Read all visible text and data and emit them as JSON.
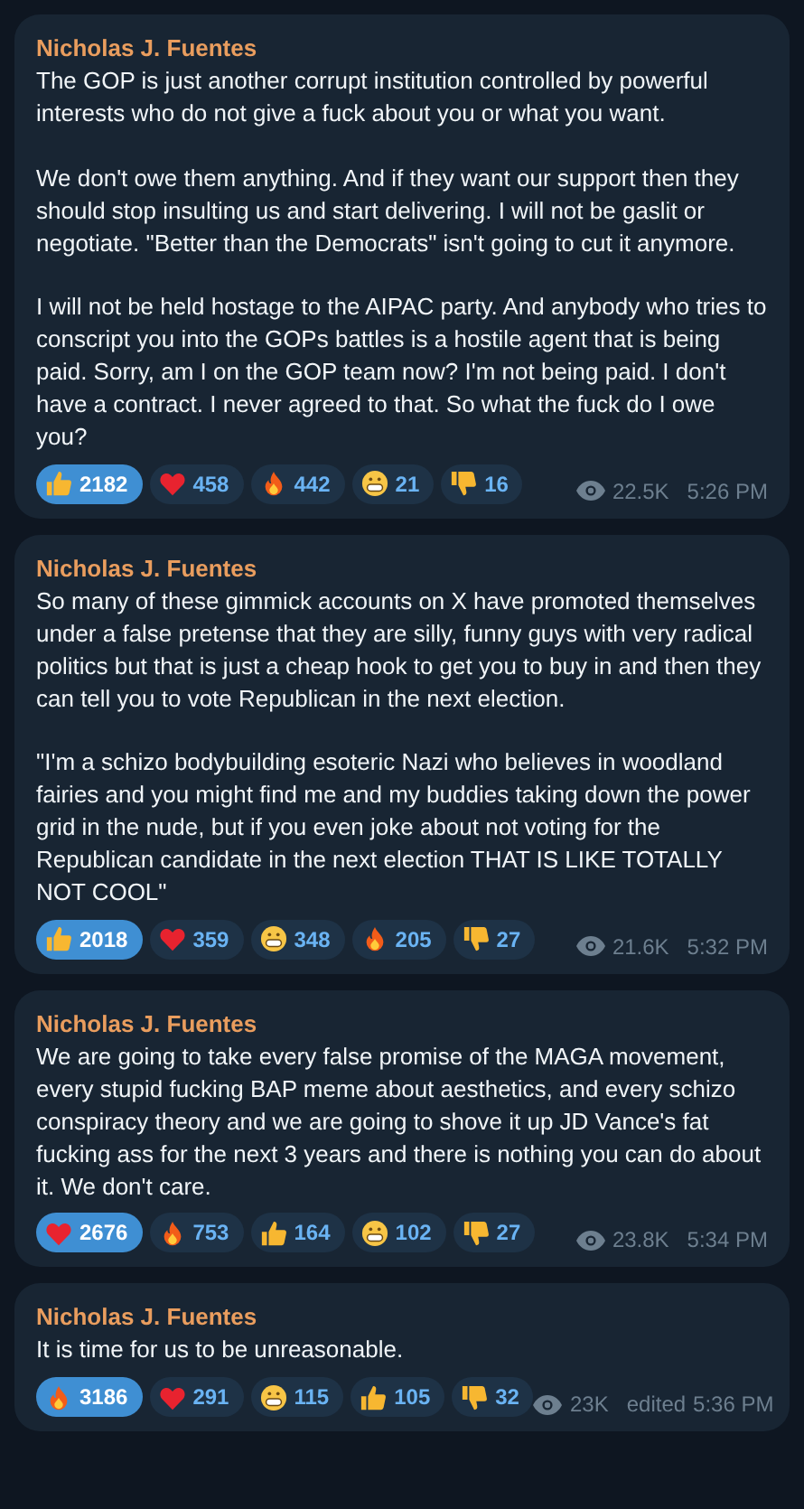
{
  "messages": [
    {
      "author": "Nicholas J. Fuentes",
      "paragraphs": [
        "The GOP is just another corrupt institution controlled by powerful interests who do not give a fuck about you or what you want.",
        "We don't owe them anything. And if they want our support then they should stop insulting us and start delivering. I will not be gaslit or negotiate. \"Better than the Democrats\" isn't going to cut it anymore.",
        "I will not be held hostage to the AIPAC party. And anybody who tries to conscript you into the GOPs battles is a hostile agent that is being paid. Sorry, am I on the GOP team now? I'm not being paid. I don't have a contract. I never agreed to that. So what the fuck do I owe you?"
      ],
      "reactions": [
        {
          "kind": "like",
          "count": "2182",
          "selected": true
        },
        {
          "kind": "heart",
          "count": "458",
          "selected": false
        },
        {
          "kind": "fire",
          "count": "442",
          "selected": false
        },
        {
          "kind": "grin",
          "count": "21",
          "selected": false
        },
        {
          "kind": "dislike",
          "count": "16",
          "selected": false
        }
      ],
      "views": "22.5K",
      "time": "5:26 PM"
    },
    {
      "author": "Nicholas J. Fuentes",
      "paragraphs": [
        "So many of these gimmick accounts on X have promoted themselves under a false pretense that they are silly, funny guys with very radical politics but that is just a cheap hook to get you to buy in and then they can tell you to vote Republican in the next election.",
        "\"I'm a schizo bodybuilding esoteric Nazi who believes in woodland fairies and you might find me and my buddies taking down the power grid in the nude, but if you even joke about not voting for the Republican candidate in the next election THAT IS LIKE TOTALLY NOT COOL\""
      ],
      "reactions": [
        {
          "kind": "like",
          "count": "2018",
          "selected": true
        },
        {
          "kind": "heart",
          "count": "359",
          "selected": false
        },
        {
          "kind": "grin",
          "count": "348",
          "selected": false
        },
        {
          "kind": "fire",
          "count": "205",
          "selected": false
        },
        {
          "kind": "dislike",
          "count": "27",
          "selected": false
        }
      ],
      "views": "21.6K",
      "time": "5:32 PM"
    },
    {
      "author": "Nicholas J. Fuentes",
      "paragraphs": [
        "We are going to take every false promise of the MAGA movement, every stupid fucking BAP meme about aesthetics, and every schizo conspiracy theory and we are going to shove it up JD Vance's fat fucking ass for the next 3 years and there is nothing you can do about it. We don't care."
      ],
      "reactions": [
        {
          "kind": "heart",
          "count": "2676",
          "selected": true
        },
        {
          "kind": "fire",
          "count": "753",
          "selected": false
        },
        {
          "kind": "like",
          "count": "164",
          "selected": false
        },
        {
          "kind": "grin",
          "count": "102",
          "selected": false
        },
        {
          "kind": "dislike",
          "count": "27",
          "selected": false
        }
      ],
      "views": "23.8K",
      "time": "5:34 PM"
    },
    {
      "author": "Nicholas J. Fuentes",
      "paragraphs": [
        "It is time for us to be unreasonable."
      ],
      "reactions": [
        {
          "kind": "fire",
          "count": "3186",
          "selected": true
        },
        {
          "kind": "heart",
          "count": "291",
          "selected": false
        },
        {
          "kind": "grin",
          "count": "115",
          "selected": false
        },
        {
          "kind": "like",
          "count": "105",
          "selected": false
        },
        {
          "kind": "dislike",
          "count": "32",
          "selected": false
        }
      ],
      "views": "23K",
      "edited": "edited",
      "time": "5:36 PM"
    }
  ]
}
